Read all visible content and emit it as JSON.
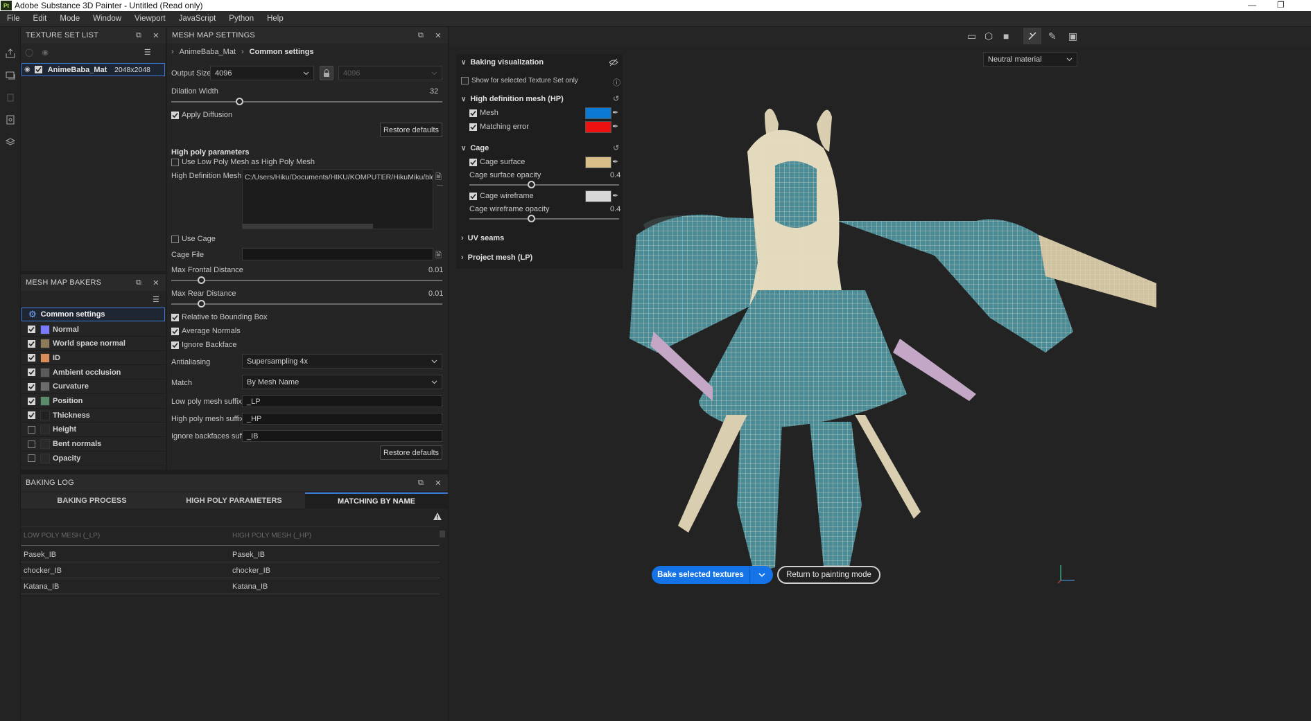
{
  "window": {
    "title": "Adobe Substance 3D Painter - Untitled (Read only)",
    "app_icon": "Pt"
  },
  "menu": [
    "File",
    "Edit",
    "Mode",
    "Window",
    "Viewport",
    "JavaScript",
    "Python",
    "Help"
  ],
  "texture_set_list": {
    "title": "TEXTURE SET LIST",
    "item": {
      "name": "AnimeBaba_Mat",
      "resolution": "2048x2048"
    }
  },
  "mesh_map_bakers": {
    "title": "MESH MAP BAKERS",
    "common": "Common settings",
    "items": [
      {
        "name": "Normal",
        "checked": true,
        "color": "#7a7aff"
      },
      {
        "name": "World space normal",
        "checked": true,
        "color": "#8c7c5c"
      },
      {
        "name": "ID",
        "checked": true,
        "color": "#d88c5a"
      },
      {
        "name": "Ambient occlusion",
        "checked": true,
        "color": "#5a5a5a"
      },
      {
        "name": "Curvature",
        "checked": true,
        "color": "#6c6c6c"
      },
      {
        "name": "Position",
        "checked": true,
        "color": "#5a8c6a"
      },
      {
        "name": "Thickness",
        "checked": true,
        "color": "#222222"
      },
      {
        "name": "Height",
        "checked": false,
        "color": "#2a2a2a"
      },
      {
        "name": "Bent normals",
        "checked": false,
        "color": "#2a2a2a"
      },
      {
        "name": "Opacity",
        "checked": false,
        "color": "#2a2a2a"
      }
    ]
  },
  "mesh_map_settings": {
    "title": "MESH MAP SETTINGS",
    "breadcrumb": [
      "AnimeBaba_Mat",
      "Common settings"
    ],
    "output_size_label": "Output Size",
    "output_size": "4096",
    "output_size_locked": "4096",
    "dilation_label": "Dilation Width",
    "dilation_value": "32",
    "dilation_fraction": 0.25,
    "apply_diffusion": "Apply Diffusion",
    "restore_defaults": "Restore defaults",
    "high_poly_title": "High poly parameters",
    "use_low_poly": "Use Low Poly Mesh as High Poly Mesh",
    "hd_meshes_label": "High Definition Meshes",
    "hd_meshes_value": "C:/Users/Hiku/Documents/HIKU/KOMPUTER/HikuMiku/blender/Ani",
    "use_cage": "Use Cage",
    "cage_file_label": "Cage File",
    "max_frontal_label": "Max Frontal Distance",
    "max_frontal_value": "0.01",
    "max_rear_label": "Max Rear Distance",
    "max_rear_value": "0.01",
    "relative_bbox": "Relative to Bounding Box",
    "average_normals": "Average Normals",
    "ignore_backface": "Ignore Backface",
    "antialiasing_label": "Antialiasing",
    "antialiasing_value": "Supersampling 4x",
    "match_label": "Match",
    "match_value": "By Mesh Name",
    "low_suffix_label": "Low poly mesh suffix",
    "low_suffix_value": "_LP",
    "high_suffix_label": "High poly mesh suffix",
    "high_suffix_value": "_HP",
    "ignore_suffix_label": "Ignore backfaces suffix",
    "ignore_suffix_value": "_IB"
  },
  "baking_log": {
    "title": "BAKING LOG",
    "tabs": [
      "BAKING PROCESS",
      "HIGH POLY PARAMETERS",
      "MATCHING BY NAME"
    ],
    "col_low": "LOW POLY MESH (_LP)",
    "col_high": "HIGH POLY MESH (_HP)",
    "rows": [
      [
        "Pasek_IB",
        "Pasek_IB"
      ],
      [
        "chocker_IB",
        "chocker_IB"
      ],
      [
        "Katana_IB",
        "Katana_IB"
      ]
    ]
  },
  "viewport": {
    "material": "Neutral material",
    "bake_button": "Bake selected textures",
    "return_button": "Return to painting mode"
  },
  "baking_visualization": {
    "title": "Baking visualization",
    "show_selected": "Show for selected Texture Set only",
    "hp_title": "High definition mesh (HP)",
    "mesh": "Mesh",
    "mesh_color": "#0a7ad4",
    "matching_error": "Matching error",
    "matching_error_color": "#ee1111",
    "cage_title": "Cage",
    "cage_surface": "Cage surface",
    "cage_surface_color": "#d8bf8a",
    "cage_surface_opacity_label": "Cage surface opacity",
    "cage_surface_opacity": "0.4",
    "cage_wireframe": "Cage wireframe",
    "cage_wireframe_color": "#d8d8d8",
    "cage_wireframe_opacity_label": "Cage wireframe opacity",
    "cage_wireframe_opacity": "0.4",
    "uv_seams": "UV seams",
    "project_mesh": "Project mesh (LP)"
  }
}
